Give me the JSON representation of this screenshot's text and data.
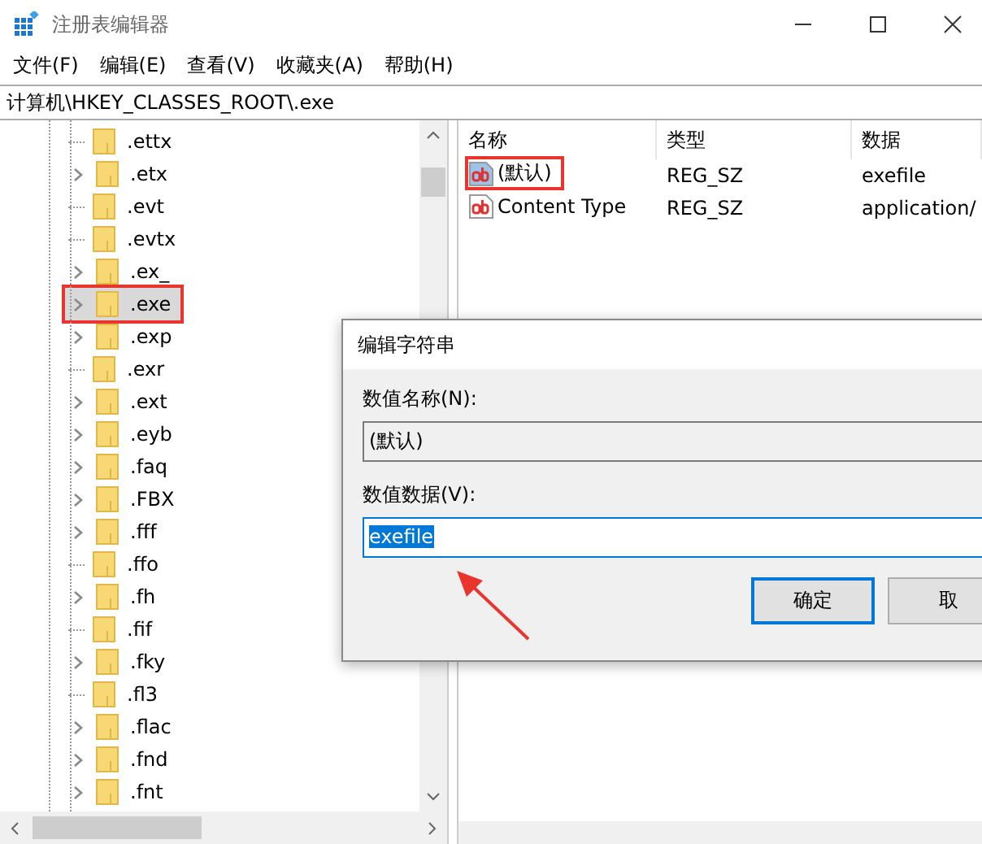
{
  "window": {
    "title": "注册表编辑器"
  },
  "menu": [
    {
      "label": "文件(F)"
    },
    {
      "label": "编辑(E)"
    },
    {
      "label": "查看(V)"
    },
    {
      "label": "收藏夹(A)"
    },
    {
      "label": "帮助(H)"
    }
  ],
  "address": "计算机\\HKEY_CLASSES_ROOT\\.exe",
  "tree": {
    "items": [
      {
        "label": ".ettx",
        "has_children": false,
        "selected": false,
        "annotated": false
      },
      {
        "label": ".etx",
        "has_children": true,
        "selected": false,
        "annotated": false
      },
      {
        "label": ".evt",
        "has_children": false,
        "selected": false,
        "annotated": false
      },
      {
        "label": ".evtx",
        "has_children": false,
        "selected": false,
        "annotated": false
      },
      {
        "label": ".ex_",
        "has_children": true,
        "selected": false,
        "annotated": false
      },
      {
        "label": ".exe",
        "has_children": true,
        "selected": true,
        "annotated": true
      },
      {
        "label": ".exp",
        "has_children": true,
        "selected": false,
        "annotated": false
      },
      {
        "label": ".exr",
        "has_children": false,
        "selected": false,
        "annotated": false
      },
      {
        "label": ".ext",
        "has_children": true,
        "selected": false,
        "annotated": false
      },
      {
        "label": ".eyb",
        "has_children": true,
        "selected": false,
        "annotated": false
      },
      {
        "label": ".faq",
        "has_children": true,
        "selected": false,
        "annotated": false
      },
      {
        "label": ".FBX",
        "has_children": true,
        "selected": false,
        "annotated": false
      },
      {
        "label": ".fff",
        "has_children": true,
        "selected": false,
        "annotated": false
      },
      {
        "label": ".ffo",
        "has_children": false,
        "selected": false,
        "annotated": false
      },
      {
        "label": ".fh",
        "has_children": true,
        "selected": false,
        "annotated": false
      },
      {
        "label": ".fif",
        "has_children": false,
        "selected": false,
        "annotated": false
      },
      {
        "label": ".fky",
        "has_children": true,
        "selected": false,
        "annotated": false
      },
      {
        "label": ".fl3",
        "has_children": false,
        "selected": false,
        "annotated": false
      },
      {
        "label": ".flac",
        "has_children": true,
        "selected": false,
        "annotated": false
      },
      {
        "label": ".fnd",
        "has_children": true,
        "selected": false,
        "annotated": false
      },
      {
        "label": ".fnt",
        "has_children": true,
        "selected": false,
        "annotated": false
      }
    ]
  },
  "list": {
    "columns": [
      "名称",
      "类型",
      "数据"
    ],
    "rows": [
      {
        "name": "(默认)",
        "type": "REG_SZ",
        "data": "exefile",
        "annotated": true
      },
      {
        "name": "Content Type",
        "type": "REG_SZ",
        "data": "application/",
        "annotated": false
      }
    ]
  },
  "dialog": {
    "title": "编辑字符串",
    "name_label": "数值名称(N):",
    "name_value": "(默认)",
    "data_label": "数值数据(V):",
    "data_value": "exefile",
    "buttons": [
      {
        "label": "确定",
        "default": true
      },
      {
        "label": "取",
        "default": false
      }
    ]
  }
}
